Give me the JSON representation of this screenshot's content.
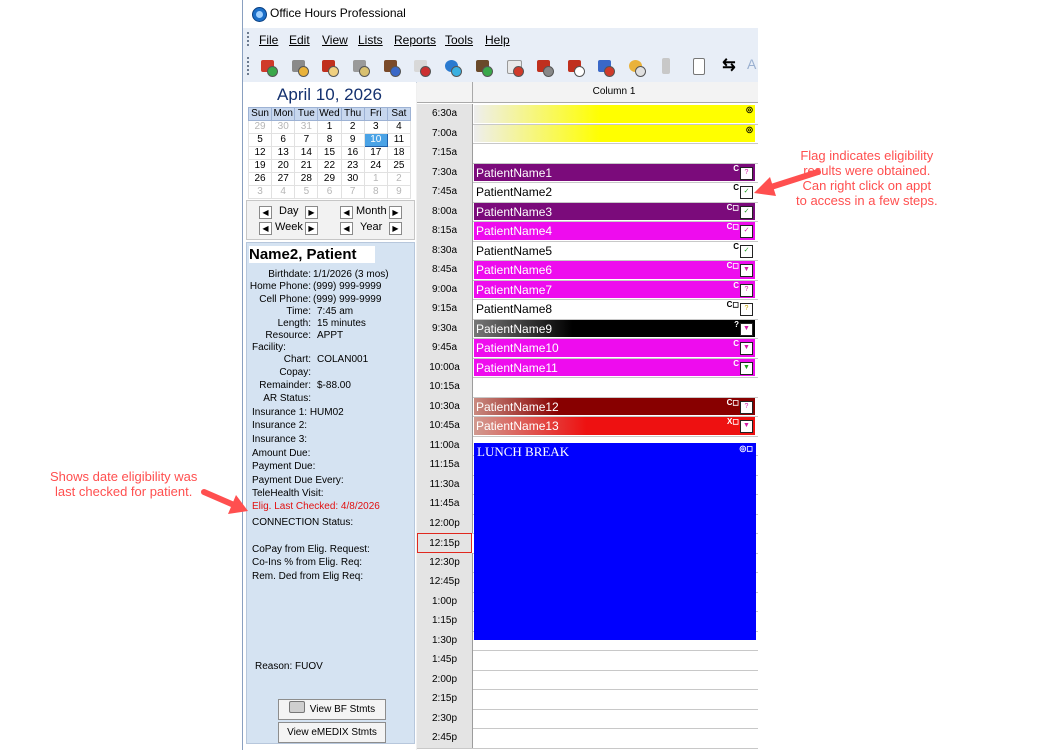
{
  "window": {
    "title": "Office Hours Professional"
  },
  "menu": [
    {
      "label": "File"
    },
    {
      "label": "Edit"
    },
    {
      "label": "View"
    },
    {
      "label": "Lists"
    },
    {
      "label": "Reports"
    },
    {
      "label": "Tools"
    },
    {
      "label": "Help"
    }
  ],
  "toolbar_icons": [
    "appointment-add-icon",
    "find-icon",
    "patient-book-icon",
    "schedule-icon",
    "patients-icon",
    "phone-icon",
    "globe-icon",
    "users-icon",
    "report-icon",
    "appointment-icon",
    "reminder-icon",
    "print-icon",
    "undo-icon",
    "door-icon",
    "list-icon",
    "swap-icon"
  ],
  "calendar": {
    "title": "April 10, 2026",
    "weekdays": [
      "Sun",
      "Mon",
      "Tue",
      "Wed",
      "Thu",
      "Fri",
      "Sat"
    ],
    "weeks": [
      [
        "29",
        "30",
        "31",
        "1",
        "2",
        "3",
        "4"
      ],
      [
        "5",
        "6",
        "7",
        "8",
        "9",
        "10",
        "11"
      ],
      [
        "12",
        "13",
        "14",
        "15",
        "16",
        "17",
        "18"
      ],
      [
        "19",
        "20",
        "21",
        "22",
        "23",
        "24",
        "25"
      ],
      [
        "26",
        "27",
        "28",
        "29",
        "30",
        "1",
        "2"
      ],
      [
        "3",
        "4",
        "5",
        "6",
        "7",
        "8",
        "9"
      ]
    ],
    "selected_day": "10"
  },
  "nav": {
    "day": "Day",
    "week": "Week",
    "month": "Month",
    "year": "Year"
  },
  "patient": {
    "name": "Name2, Patient",
    "fields": [
      {
        "label": "Birthdate:",
        "value": "1/1/2026 (3 mos)"
      },
      {
        "label": "Home Phone:",
        "value": "(999) 999-9999"
      },
      {
        "label": "Cell Phone:",
        "value": "(999) 999-9999"
      },
      {
        "label": "Time:",
        "value": "7:45 am"
      },
      {
        "label": "Length:",
        "value": "15 minutes"
      },
      {
        "label": "Resource:",
        "value": "APPT"
      }
    ],
    "facility_label": "Facility:",
    "fields2": [
      {
        "label": "Chart:",
        "value": "COLAN001"
      },
      {
        "label": "Copay:",
        "value": ""
      },
      {
        "label": "Remainder:",
        "value": "$-88.00"
      },
      {
        "label": "AR Status:",
        "value": ""
      }
    ],
    "lines": [
      "Insurance 1: HUM02",
      "Insurance 2:",
      "Insurance 3:",
      "Amount Due:",
      "Payment Due:",
      "Payment Due Every:",
      "TeleHealth Visit:"
    ],
    "elig_checked": "Elig. Last Checked: 4/8/2026",
    "connection_status": "CONNECTION Status:",
    "elig_lines": [
      "CoPay from Elig. Request:",
      "Co-Ins % from Elig. Req:",
      "Rem. Ded from Elig Req:"
    ],
    "reason": "Reason:  FUOV",
    "btn_bf": "View BF Stmts",
    "btn_emedix": "View eMEDIX Stmts"
  },
  "schedule": {
    "column_title": "Column 1",
    "slots": [
      "6:30a",
      "7:00a",
      "7:15a",
      "7:30a",
      "7:45a",
      "8:00a",
      "8:15a",
      "8:30a",
      "8:45a",
      "9:00a",
      "9:15a",
      "9:30a",
      "9:45a",
      "10:00a",
      "10:15a",
      "10:30a",
      "10:45a",
      "11:00a",
      "11:15a",
      "11:30a",
      "11:45a",
      "12:00p",
      "12:15p",
      "12:30p",
      "12:45p",
      "1:00p",
      "1:15p",
      "1:30p",
      "1:45p",
      "2:00p",
      "2:15p",
      "2:30p",
      "2:45p"
    ],
    "current_slot": "12:15p",
    "appointments": [
      {
        "slot": "7:30a",
        "name": "PatientName1",
        "bg": "#7b0b7b",
        "fg": "#ffffff",
        "flags": "C",
        "elig": "?",
        "elig_color": "#d11aa6"
      },
      {
        "slot": "7:45a",
        "name": "PatientName2",
        "bg": "#ffffff",
        "fg": "#000000",
        "flags": "C",
        "elig": "✓",
        "elig_color": "#1a9a1a"
      },
      {
        "slot": "8:00a",
        "name": "PatientName3",
        "bg": "#7b0b7b",
        "fg": "#ffffff",
        "flags": "C◻",
        "elig": "✓",
        "elig_color": "#1a9a1a"
      },
      {
        "slot": "8:15a",
        "name": "PatientName4",
        "bg": "#ee0cee",
        "fg": "#ffffff",
        "flags": "C◻",
        "elig": "✓",
        "elig_color": "#d11aa6"
      },
      {
        "slot": "8:30a",
        "name": "PatientName5",
        "bg": "#ffffff",
        "fg": "#000000",
        "flags": "C",
        "elig": "✓",
        "elig_color": "#1a9a1a"
      },
      {
        "slot": "8:45a",
        "name": "PatientName6",
        "bg": "#ee0cee",
        "fg": "#ffffff",
        "flags": "C◻",
        "elig": "▼",
        "elig_color": "#d11aa6"
      },
      {
        "slot": "9:00a",
        "name": "PatientName7",
        "bg": "#ee0cee",
        "fg": "#ffffff",
        "flags": "C",
        "elig": "?",
        "elig_color": "#d11aa6"
      },
      {
        "slot": "9:15a",
        "name": "PatientName8",
        "bg": "#ffffff",
        "fg": "#000000",
        "flags": "C◻",
        "elig": "?",
        "elig_color": "#c9a400"
      },
      {
        "slot": "9:30a",
        "name": "PatientName9",
        "bg": "#000000",
        "fg": "#ffffff",
        "flags": "?",
        "elig": "▼",
        "elig_color": "#d11aa6"
      },
      {
        "slot": "9:45a",
        "name": "PatientName10",
        "bg": "#ee0cee",
        "fg": "#ffffff",
        "flags": "C",
        "elig": "▼",
        "elig_color": "#d11aa6"
      },
      {
        "slot": "10:00a",
        "name": "PatientName11",
        "bg": "#ee0cee",
        "fg": "#ffffff",
        "flags": "C",
        "elig": "▼",
        "elig_color": "#1a9a1a"
      },
      {
        "slot": "10:30a",
        "name": "PatientName12",
        "bg": "#880000",
        "fg": "#ffffff",
        "flags": "C◻",
        "elig": "?",
        "elig_color": "#d11aa6"
      },
      {
        "slot": "10:45a",
        "name": "PatientName13",
        "bg": "#ee1111",
        "fg": "#ffffff",
        "flags": "X◻",
        "elig": "▼",
        "elig_color": "#d11aa6"
      }
    ],
    "lunch": "LUNCH BREAK"
  },
  "annotations": {
    "right": [
      "Flag indicates eligibility",
      "results were obtained.",
      "Can right click on appt",
      "to access in a few steps."
    ],
    "left": [
      "Shows date eligibility was",
      "last checked for patient."
    ]
  }
}
